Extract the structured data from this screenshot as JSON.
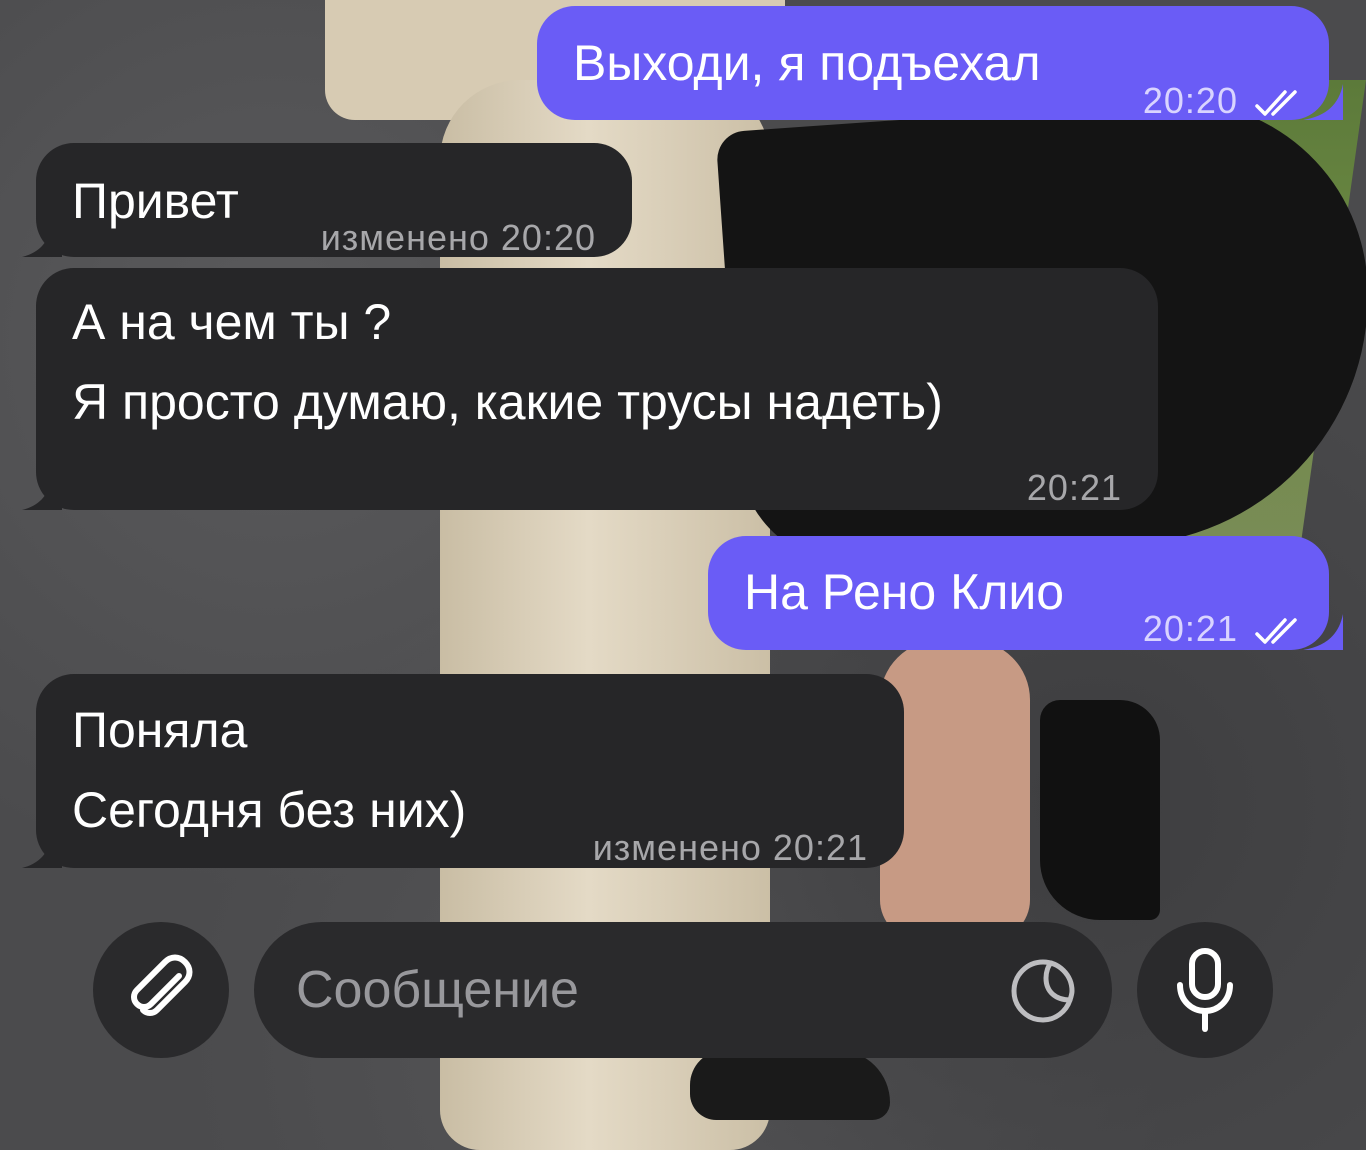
{
  "messages": [
    {
      "direction": "out",
      "text": "Выходи, я подъехал",
      "time": "20:20",
      "status_icon": "double-check-icon"
    },
    {
      "direction": "in",
      "text": "Привет",
      "edited_label": "изменено",
      "time": "20:20"
    },
    {
      "direction": "in",
      "lines": [
        "А на чем ты ?",
        "Я просто думаю, какие трусы надеть)"
      ],
      "time": "20:21"
    },
    {
      "direction": "out",
      "text": "На Рено Клио",
      "time": "20:21",
      "status_icon": "double-check-icon"
    },
    {
      "direction": "in",
      "lines": [
        "Поняла",
        "Сегодня без них)"
      ],
      "edited_label": "изменено",
      "time": "20:21"
    }
  ],
  "composer": {
    "placeholder": "Сообщение",
    "attach_icon": "paperclip-icon",
    "sticker_icon": "sticker-icon",
    "mic_icon": "microphone-icon"
  },
  "colors": {
    "outgoing_bubble": "#6a5cf6",
    "incoming_bubble": "#262628",
    "composer_bg": "#2a2a2c"
  }
}
